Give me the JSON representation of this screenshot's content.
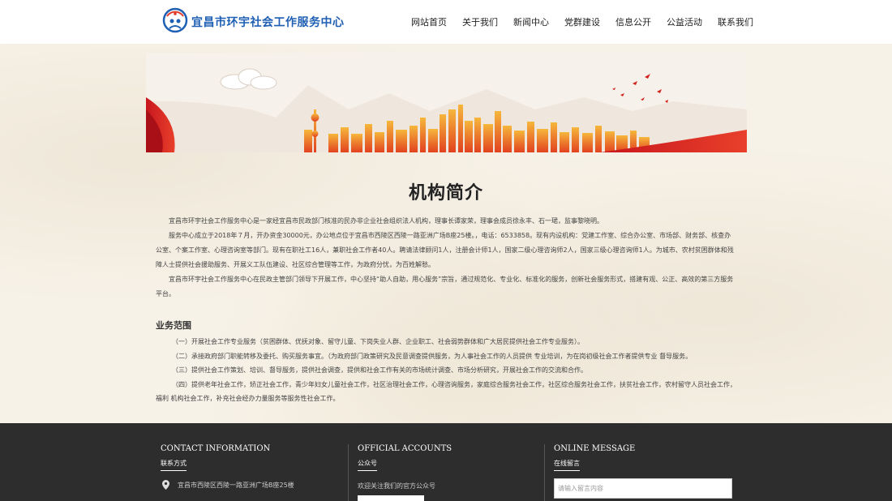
{
  "header": {
    "site_title": "宜昌市环宇社会工作服务中心",
    "nav": [
      "网站首页",
      "关于我们",
      "新闻中心",
      "党群建设",
      "信息公开",
      "公益活动",
      "联系我们"
    ]
  },
  "main": {
    "title": "机构简介",
    "intro": [
      "宜昌市环宇社会工作服务中心是一家经宜昌市民政部门核准的民办非企业社会组织法人机构，理事长谭家荣，理事会成员徐永丰、石一珺，监事黎晓明。",
      "服务中心成立于2018年７月，开办资金30000元，办公地点位于宜昌市西陵区西陵一路亚洲广场B座25楼。，电话：6533858。现有内设机构：党建工作室、综合办公室、市场部、财务部、核查办公室、个案工作室、心理咨询室等部门。现有在职社工16人，兼职社会工作者40人。聘请法律顾问1人，注册会计师1人，国家二级心理咨询师2人，国家三级心理咨询师1人。为城市、农村贫困群体和残障人士提供社会援助服务、开展义工队伍建设、社区综合管理等工作，为政府分忧，为百姓解愁。",
      "宜昌市环宇社会工作服务中心在民政主管部门领导下开展工作，中心坚持“助人自助，用心服务”宗旨，通过规范化、专业化、标准化的服务，创新社会服务形式，搭建有观、公正、高效的第三方服务平台。"
    ],
    "scope_title": "业务范围",
    "scope": [
      "（一）开展社会工作专业服务（贫困群体、优抚对象、留守儿童、下岗失业人群、企业职工、社会弱势群体和广大居民提供社会工作专业服务）。",
      "（二）承接政府部门职能转移及委托、购买服务事宜。（为政府部门政策研究及民意调查提供服务，为人事社会工作的人员提供 专业培训，为在岗初级社会工作者提供专业 督导服务。",
      "（三）提供社会工作策划、培训、督导服务，提供社会调查，提供和社会工作有关的市场统计调查、市场分析研究，开展社会工作的交流和合作。",
      "（四）提供老年社会工作，矫正社会工作，青少年妇女儿童社会工作，社区治理社会工作，心理咨询服务，家庭综合服务社会工作，社区综合服务社会工作，扶贫社会工作，农村留守人员社会工作，福利 机构社会工作，补充社会经办力量服务等服务性社会工作。"
    ]
  },
  "footer": {
    "contact": {
      "title": "CONTACT INFORMATION",
      "sub": "联系方式",
      "address": "宜昌市西陵区西陵一路亚洲广场B座25楼"
    },
    "accounts": {
      "title": "OFFICIAL ACCOUNTS",
      "sub": "公众号",
      "follow": "欢迎关注我们的官方公众号"
    },
    "message": {
      "title": "ONLINE MESSAGE",
      "sub": "在线留言",
      "placeholder": "请输入留言内容"
    }
  }
}
